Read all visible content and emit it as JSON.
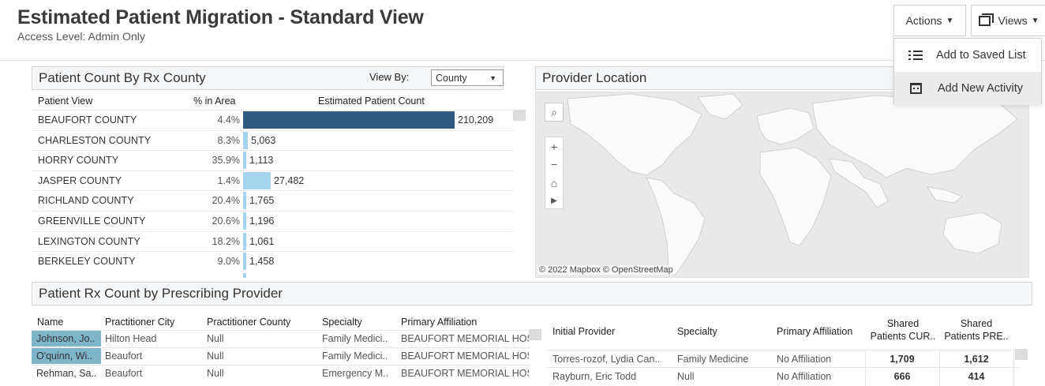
{
  "header": {
    "title": "Estimated Patient Migration - Standard View",
    "subtitle": "Access Level: Admin Only"
  },
  "toolbar": {
    "actions_label": "Actions",
    "views_label": "Views"
  },
  "actions_menu": {
    "items": [
      {
        "label": "Add to Saved List",
        "icon": "list-icon"
      },
      {
        "label": "Add New Activity",
        "icon": "calendar-icon"
      }
    ]
  },
  "rx_county": {
    "title": "Patient Count By Rx County",
    "view_by_label": "View By:",
    "view_by_value": "County",
    "columns": [
      "Patient View",
      "% in Area",
      "Estimated Patient Count"
    ],
    "bar_color_primary": "#2e5a82",
    "bar_color_secondary": "#a5d4ef",
    "rows": [
      {
        "name": "BEAUFORT COUNTY",
        "pct": "4.4%",
        "count": 210209,
        "count_label": "210,209"
      },
      {
        "name": "CHARLESTON COUNTY",
        "pct": "8.3%",
        "count": 5063,
        "count_label": "5,063"
      },
      {
        "name": "HORRY COUNTY",
        "pct": "35.9%",
        "count": 1113,
        "count_label": "1,113"
      },
      {
        "name": "JASPER COUNTY",
        "pct": "1.4%",
        "count": 27482,
        "count_label": "27,482"
      },
      {
        "name": "RICHLAND COUNTY",
        "pct": "20.4%",
        "count": 1765,
        "count_label": "1,765"
      },
      {
        "name": "GREENVILLE COUNTY",
        "pct": "20.6%",
        "count": 1196,
        "count_label": "1,196"
      },
      {
        "name": "LEXINGTON COUNTY",
        "pct": "18.2%",
        "count": 1061,
        "count_label": "1,061"
      },
      {
        "name": "BERKELEY COUNTY",
        "pct": "9.0%",
        "count": 1458,
        "count_label": "1,458"
      }
    ]
  },
  "provider_location": {
    "title": "Provider Location",
    "attribution": "© 2022 Mapbox  © OpenStreetMap",
    "controls": [
      "search-icon",
      "zoom-in-icon",
      "zoom-out-icon",
      "home-icon",
      "play-icon"
    ]
  },
  "rx_provider": {
    "title": "Patient Rx Count by Prescribing Provider",
    "columns": [
      "Name",
      "Practitioner City",
      "Practitioner County",
      "Specialty",
      "Primary Affiliation"
    ],
    "rows": [
      {
        "name": "Johnson, Jo..",
        "city": "Hilton Head",
        "county": "Null",
        "specialty": "Family Medici..",
        "affiliation": "BEAUFORT MEMORIAL HOS",
        "selected": true
      },
      {
        "name": "O'quinn, Wi..",
        "city": "Beaufort",
        "county": "Null",
        "specialty": "Family Medici..",
        "affiliation": "BEAUFORT MEMORIAL HOS",
        "selected": true
      },
      {
        "name": "Rehman, Sa..",
        "city": "Beaufort",
        "county": "Null",
        "specialty": "Emergency M..",
        "affiliation": "BEAUFORT MEMORIAL HOS",
        "selected": false
      }
    ],
    "selected_color": "#7fb5c9"
  },
  "initial_provider": {
    "columns": [
      "Initial Provider",
      "Specialty",
      "Primary Affiliation",
      "Shared Patients CUR..",
      "Shared Patients PRE.."
    ],
    "col_top": [
      "",
      "",
      "",
      "Shared",
      "Shared"
    ],
    "col_bottom": [
      "Initial Provider",
      "Specialty",
      "Primary Affiliation",
      "Patients CUR..",
      "Patients PRE.."
    ],
    "rows": [
      {
        "provider": "Torres-rozof, Lydia Can..",
        "specialty": "Family Medicine",
        "affiliation": "No Affiliation",
        "cur": "1,709",
        "pre": "1,612"
      },
      {
        "provider": "Rayburn, Eric Todd",
        "specialty": "Null",
        "affiliation": "No Affiliation",
        "cur": "666",
        "pre": "414"
      }
    ]
  }
}
